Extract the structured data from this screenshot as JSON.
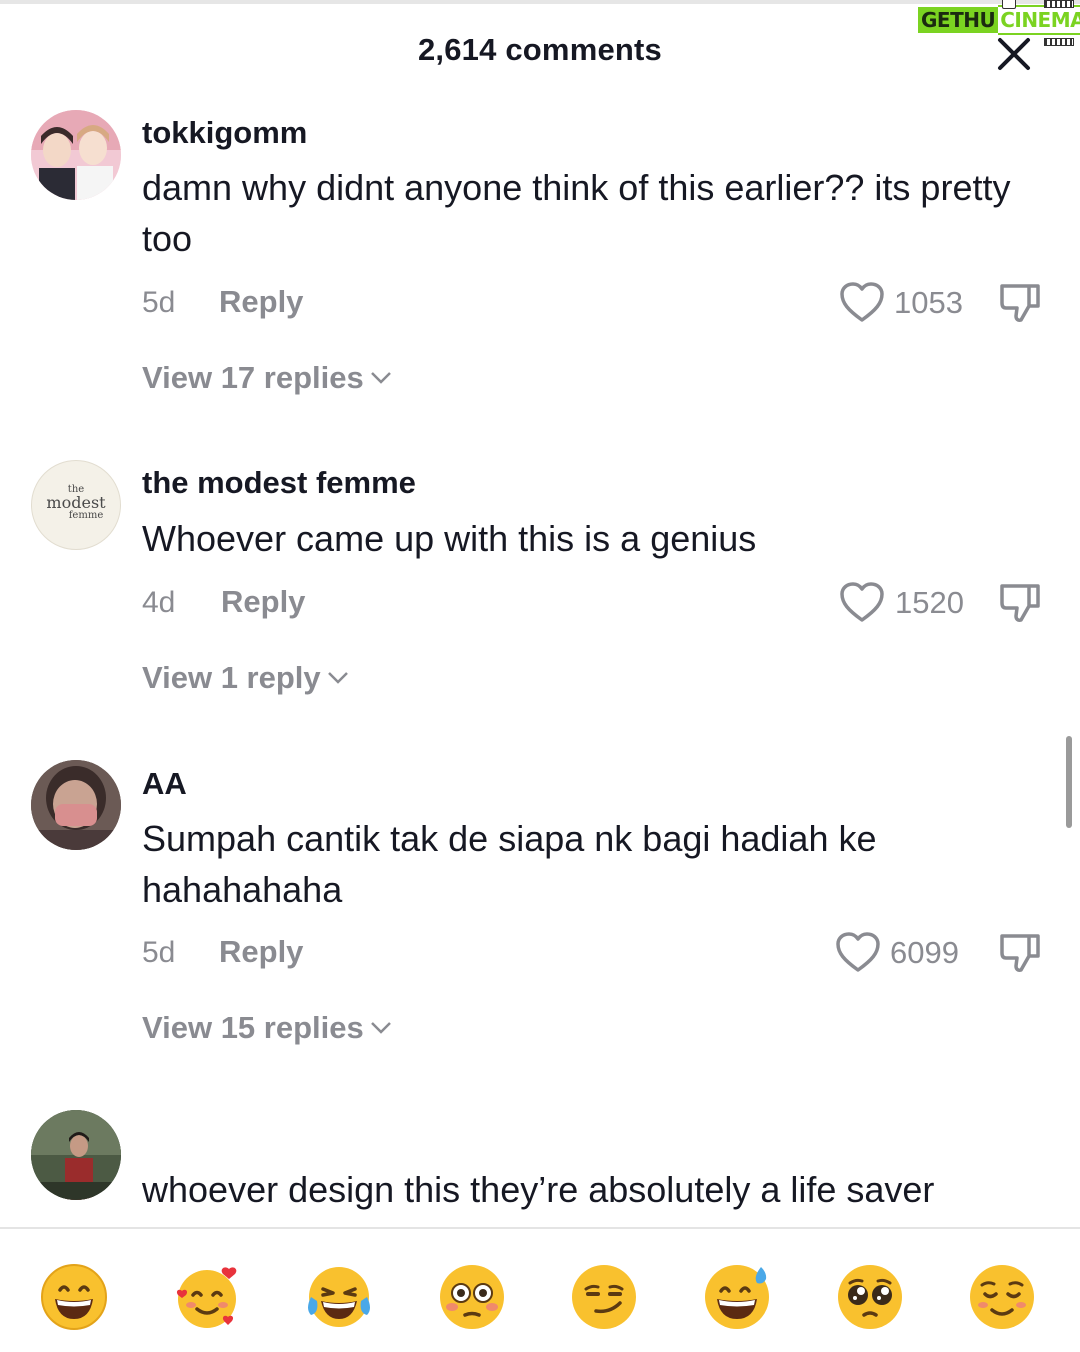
{
  "header": {
    "title": "2,614 comments"
  },
  "watermark": {
    "part1": "GETHU",
    "part2": "CINEMA"
  },
  "comments": [
    {
      "username": "tokkigomm",
      "text": "damn why didnt anyone think of this earlier?? its pretty too",
      "age": "5d",
      "reply_label": "Reply",
      "likes": "1053",
      "view_replies": "View 17 replies"
    },
    {
      "username": "the modest femme",
      "avatar_text": {
        "line1": "the",
        "line2": "modest",
        "line3": "femme"
      },
      "text": "Whoever came up with this is a genius",
      "age": "4d",
      "reply_label": "Reply",
      "likes": "1520",
      "view_replies": "View 1 reply"
    },
    {
      "username": "AA",
      "text": "Sumpah cantik tak de siapa nk bagi hadiah ke hahahahaha",
      "age": "5d",
      "reply_label": "Reply",
      "likes": "6099",
      "view_replies": "View 15 replies"
    },
    {
      "username": "",
      "text": "whoever design this they’re absolutely a life saver"
    }
  ],
  "emoji_bar": [
    "grinning-face",
    "smiling-face-with-hearts",
    "face-with-tears-of-joy",
    "flushed-face",
    "smirking-face",
    "grinning-face-with-sweat",
    "pleading-face",
    "relieved-face"
  ],
  "colors": {
    "text": "#161823",
    "muted": "#8a8b91",
    "emoji": "#f9c12e"
  }
}
